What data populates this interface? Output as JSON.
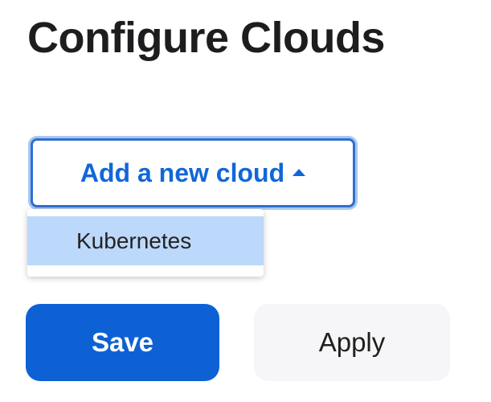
{
  "page": {
    "title": "Configure Clouds"
  },
  "add_cloud": {
    "label": "Add a new cloud",
    "caret_icon": "caret-up-icon",
    "expanded": true
  },
  "dropdown": {
    "items": [
      {
        "label": "Kubernetes",
        "highlighted": true
      }
    ]
  },
  "actions": {
    "save_label": "Save",
    "apply_label": "Apply"
  },
  "colors": {
    "accent": "#1167d8",
    "primary_button": "#0d61d4",
    "highlight": "#bcd8fb",
    "secondary_button": "#f6f6f8"
  }
}
